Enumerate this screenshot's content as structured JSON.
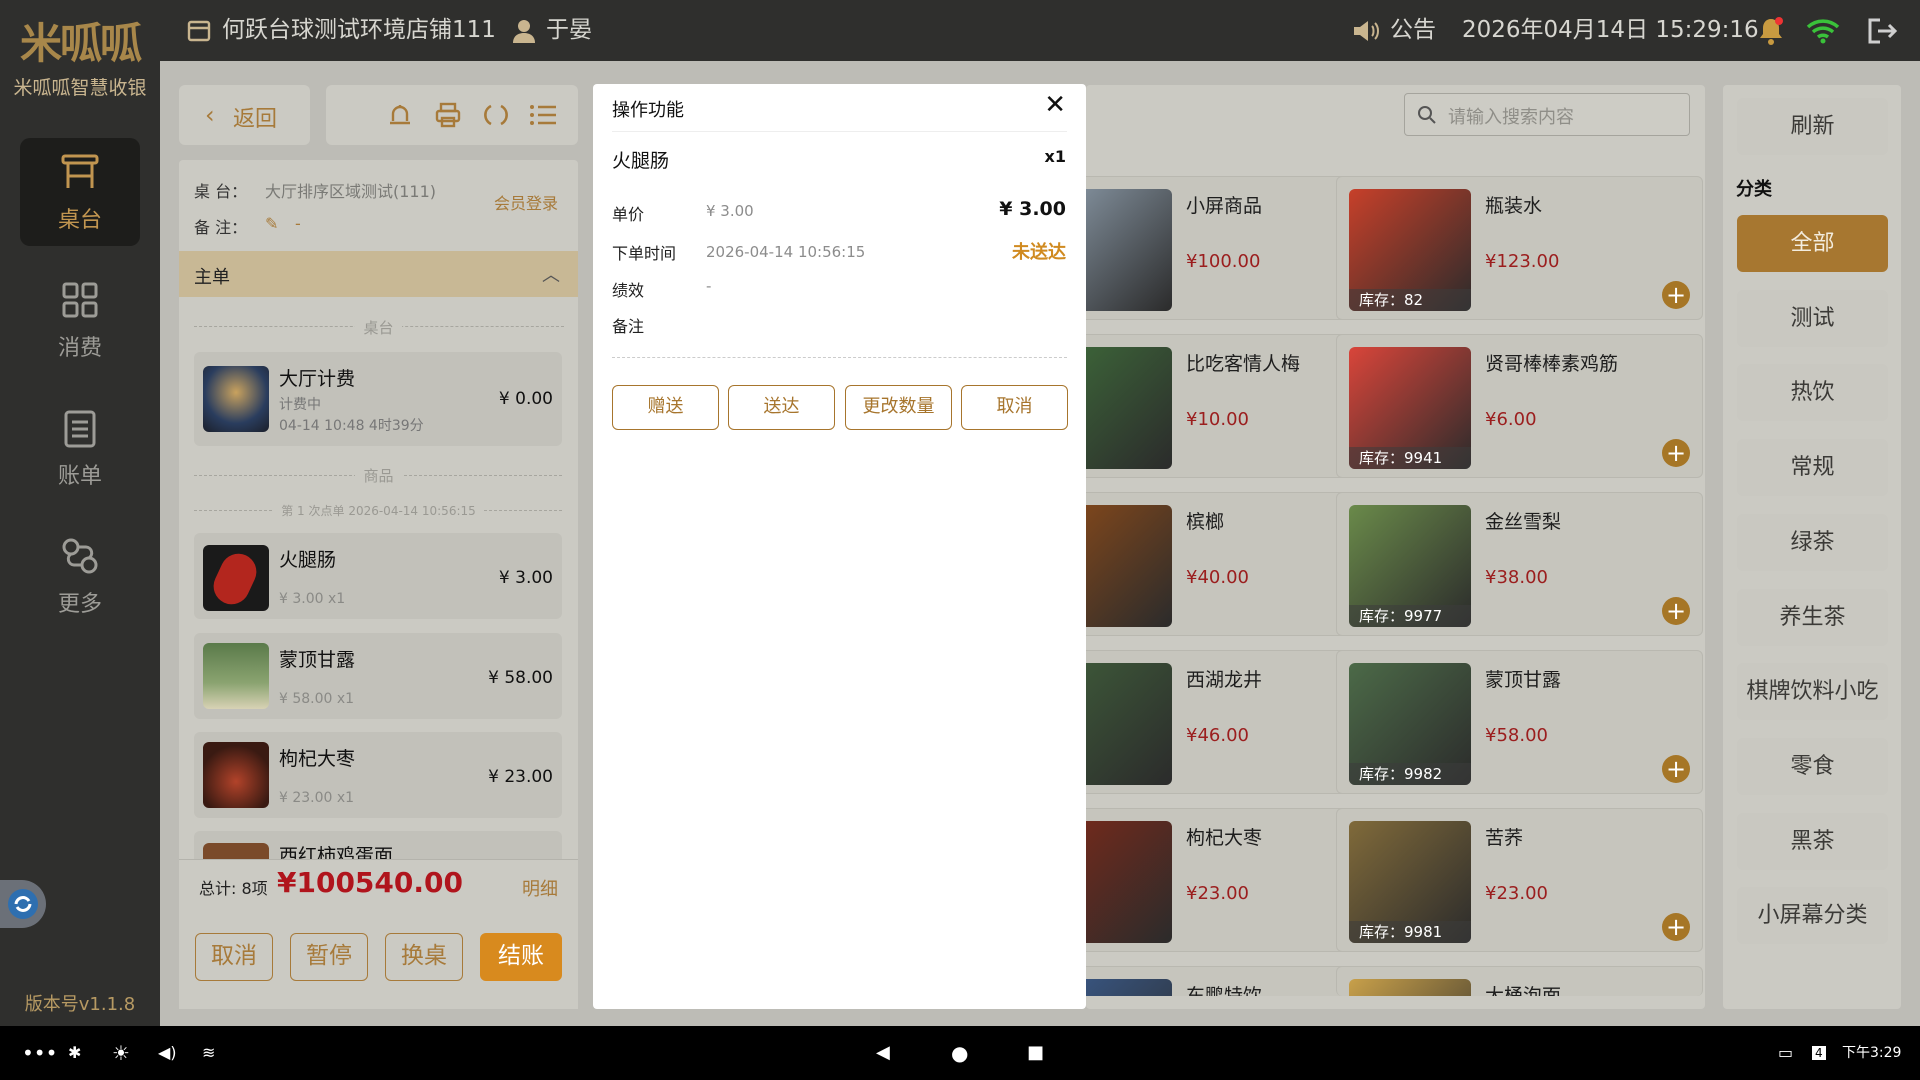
{
  "header": {
    "store": "何跃台球测试环境店铺111",
    "user": "于晏",
    "notice": "公告",
    "datetime": "2026年04月14日  15:29:16"
  },
  "sidebar": {
    "brand": "米呱呱",
    "brand_sub": "米呱呱智慧收银",
    "items": [
      {
        "label": "桌台"
      },
      {
        "label": "消费"
      },
      {
        "label": "账单"
      },
      {
        "label": "更多"
      }
    ],
    "version": "版本号v1.1.8"
  },
  "order": {
    "back": "返回",
    "table_label": "桌 台：",
    "table_value": "大厅排序区域测试(111)",
    "member_login": "会员登录",
    "remark_label": "备 注：",
    "remark_value": "-",
    "main_order": "主单",
    "sec_table": "桌台",
    "sec_goods": "商品",
    "batch": "第 1 次点单 2026-04-14 10:56:15",
    "table_item": {
      "name": "大厅计费",
      "status": "计费中",
      "time": "04-14 10:48  4时39分",
      "price": "¥ 0.00"
    },
    "items": [
      {
        "name": "火腿肠",
        "sub": "¥ 3.00 x1",
        "price": "¥ 3.00"
      },
      {
        "name": "蒙顶甘露",
        "sub": "¥ 58.00 x1",
        "price": "¥ 58.00"
      },
      {
        "name": "枸杞大枣",
        "sub": "¥ 23.00 x1",
        "price": "¥ 23.00"
      },
      {
        "name": "西红柿鸡蛋面",
        "sub": "",
        "price": ""
      }
    ],
    "total_label": "总计: 8项",
    "total": "¥100540.00",
    "detail": "明细",
    "actions": {
      "cancel": "取消",
      "pause": "暂停",
      "change": "换桌",
      "checkout": "结账"
    }
  },
  "search": {
    "placeholder": "请输入搜索内容"
  },
  "products": [
    {
      "name": "小屏商品",
      "price": "¥100.00",
      "stock": ""
    },
    {
      "name": "瓶装水",
      "price": "¥123.00",
      "stock": "库存：82"
    },
    {
      "name": "比吃客情人梅",
      "price": "¥10.00",
      "stock": ""
    },
    {
      "name": "贤哥棒棒素鸡筋",
      "price": "¥6.00",
      "stock": "库存：9941"
    },
    {
      "name": "槟榔",
      "price": "¥40.00",
      "stock": ""
    },
    {
      "name": "金丝雪梨",
      "price": "¥38.00",
      "stock": "库存：9977"
    },
    {
      "name": "西湖龙井",
      "price": "¥46.00",
      "stock": ""
    },
    {
      "name": "蒙顶甘露",
      "price": "¥58.00",
      "stock": "库存：9982"
    },
    {
      "name": "枸杞大枣",
      "price": "¥23.00",
      "stock": ""
    },
    {
      "name": "苦荞",
      "price": "¥23.00",
      "stock": "库存：9981"
    },
    {
      "name": "东鹏特饮",
      "price": "",
      "stock": ""
    },
    {
      "name": "大桶泡面",
      "price": "",
      "stock": ""
    }
  ],
  "categories": {
    "refresh": "刷新",
    "title": "分类",
    "items": [
      "全部",
      "测试",
      "热饮",
      "常规",
      "绿茶",
      "养生茶",
      "棋牌饮料小吃",
      "零食",
      "黑茶",
      "小屏幕分类"
    ]
  },
  "modal": {
    "title": "操作功能",
    "item": "火腿肠",
    "qty": "x1",
    "price_label": "单价",
    "price_small": "¥ 3.00",
    "price_big": "¥ 3.00",
    "time_label": "下单时间",
    "time_value": "2026-04-14 10:56:15",
    "status": "未送达",
    "perf_label": "绩效",
    "perf_value": "-",
    "remark_label": "备注",
    "buttons": {
      "gift": "赠送",
      "deliver": "送达",
      "change_qty": "更改数量",
      "cancel": "取消"
    }
  },
  "sysbar": {
    "clock": "下午3:29",
    "battery": "4"
  },
  "colors": {
    "accent": "#a77730",
    "price_red": "#b0141c",
    "status_orange": "#d08a20"
  }
}
